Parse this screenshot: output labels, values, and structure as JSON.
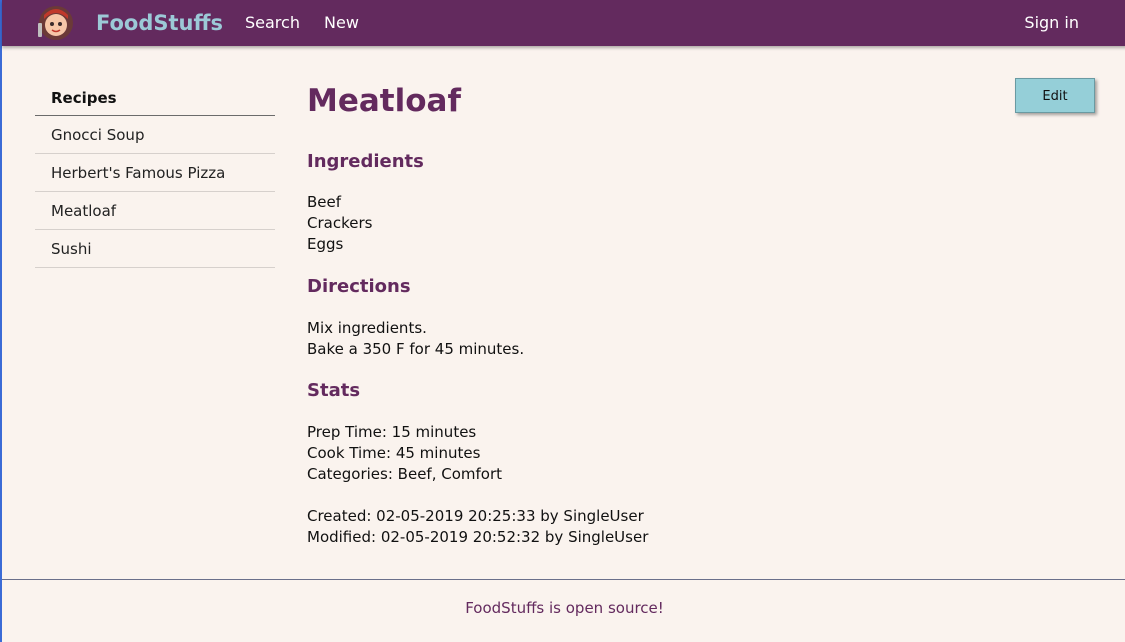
{
  "navbar": {
    "brand": "FoodStuffs",
    "links": [
      "Search",
      "New"
    ],
    "sign_in": "Sign in"
  },
  "sidebar": {
    "header": "Recipes",
    "items": [
      "Gnocci Soup",
      "Herbert's Famous Pizza",
      "Meatloaf",
      "Sushi"
    ]
  },
  "recipe": {
    "title": "Meatloaf",
    "edit_label": "Edit",
    "ingredients_heading": "Ingredients",
    "ingredients": [
      "Beef",
      "Crackers",
      "Eggs"
    ],
    "directions_heading": "Directions",
    "directions": [
      "Mix ingredients.",
      "Bake a 350 F for 45 minutes."
    ],
    "stats_heading": "Stats",
    "stats": [
      "Prep Time: 15 minutes",
      "Cook Time: 45 minutes",
      "Categories: Beef, Comfort"
    ],
    "meta": [
      "Created: 02-05-2019 20:25:33 by SingleUser",
      "Modified: 02-05-2019 20:52:32 by SingleUser"
    ]
  },
  "footer": {
    "text": "FoodStuffs is open source!"
  },
  "colors": {
    "navbar": "#632a5e",
    "brand": "#9cc9d7",
    "accent": "#632a5e",
    "edit_button": "#95cfd8",
    "background": "#faf3ee"
  }
}
